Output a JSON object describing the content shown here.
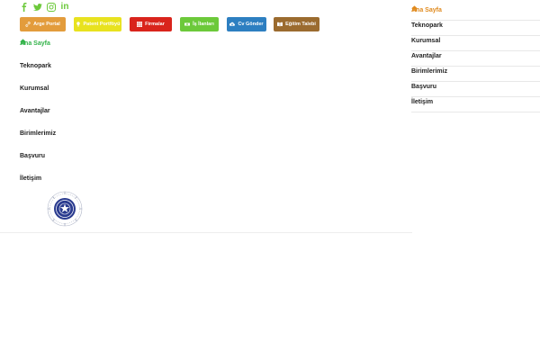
{
  "social": {
    "linkedin_text": "in",
    "color": "#6cc93a"
  },
  "top_buttons": [
    {
      "label": "Arge Portal",
      "icon": "link-icon",
      "color": "#e39c3c"
    },
    {
      "label": "Patent Portföyü",
      "icon": "bulb-icon",
      "color": "#e8e21f"
    },
    {
      "label": "Firmalar",
      "icon": "grid-icon",
      "color": "#d9241c"
    },
    {
      "label": "İş İlanları",
      "icon": "money-icon",
      "color": "#6cc93a"
    },
    {
      "label": "Cv Gönder",
      "icon": "cloud-upload-icon",
      "color": "#2d7fc1"
    },
    {
      "label": "Eğitim Talebi",
      "icon": "book-icon",
      "color": "#9b6b2f"
    }
  ],
  "left_menu": {
    "items": [
      "Ana Sayfa",
      "Teknopark",
      "Kurumsal",
      "Avantajlar",
      "Birimlerimiz",
      "Başvuru",
      "İletişim"
    ],
    "active_color": "#33b34a"
  },
  "right_menu": {
    "items": [
      "Ana Sayfa",
      "Teknopark",
      "Kurumsal",
      "Avantajlar",
      "Birimlerimiz",
      "Başvuru",
      "İletişim"
    ],
    "active_color": "#e08a1e"
  }
}
